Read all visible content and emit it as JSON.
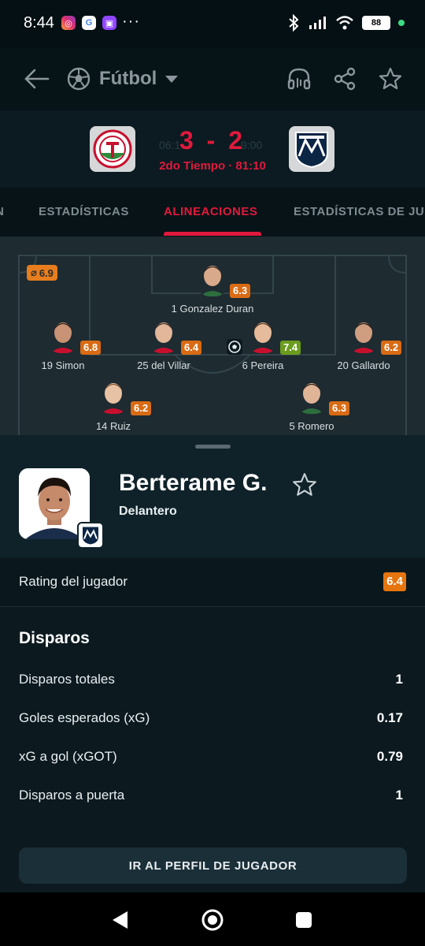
{
  "status_bar": {
    "time": "8:44",
    "apps": [
      "instagram-icon",
      "google-icon",
      "twitch-icon"
    ],
    "more": "···",
    "battery": "88"
  },
  "top_bar": {
    "sport": "Fútbol"
  },
  "match": {
    "home_time": "06:1",
    "away_time": "9:00",
    "score": "3 - 2",
    "status": "2do Tiempo · 81:10"
  },
  "tabs": [
    {
      "label": "N"
    },
    {
      "label": "ESTADÍSTICAS"
    },
    {
      "label": "ALINEACIONES"
    },
    {
      "label": "ESTADÍSTICAS DE JU"
    }
  ],
  "lineup": {
    "avg_rating": "6.9",
    "players": [
      {
        "name": "1 Gonzalez Duran",
        "rating": "6.3"
      },
      {
        "name": "19 Simon",
        "rating": "6.8"
      },
      {
        "name": "25 del Villar",
        "rating": "6.4"
      },
      {
        "name": "6 Pereira",
        "rating": "7.4"
      },
      {
        "name": "20 Gallardo",
        "rating": "6.2"
      },
      {
        "name": "14 Ruiz",
        "rating": "6.2"
      },
      {
        "name": "5 Romero",
        "rating": "6.3"
      }
    ]
  },
  "player_sheet": {
    "name": "Berterame G.",
    "position": "Delantero",
    "rating_label": "Rating del jugador",
    "rating": "6.4",
    "section_title": "Disparos",
    "stats": [
      {
        "label": "Disparos totales",
        "value": "1"
      },
      {
        "label": "Goles esperados (xG)",
        "value": "0.17"
      },
      {
        "label": "xG a gol (xGOT)",
        "value": "0.79"
      },
      {
        "label": "Disparos a puerta",
        "value": "1"
      }
    ],
    "profile_button": "IR AL PERFIL DE JUGADOR"
  },
  "colors": {
    "accent": "#e1193c",
    "rating_orange": "#e6750f",
    "rating_green": "#6b9c1e",
    "background": "#071317"
  }
}
